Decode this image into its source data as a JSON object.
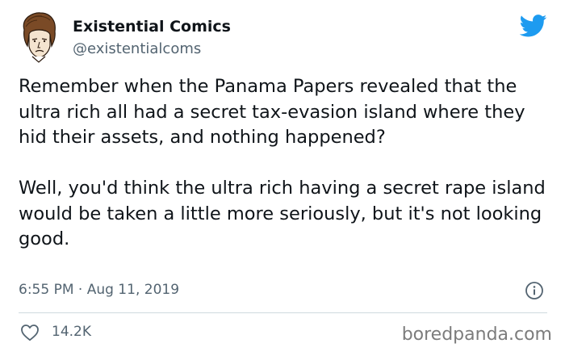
{
  "author": {
    "name": "Existential Comics",
    "handle": "@existentialcoms",
    "avatar_icon": "cartoon-face-avatar"
  },
  "platform_icon": "twitter-bird-icon",
  "brand_color": "#1d9bf0",
  "tweet": {
    "paragraphs": [
      "Remember when the Panama Papers revealed that the ultra rich all had a secret tax-evasion island where they hid their assets, and nothing happened?",
      "Well, you'd think the ultra rich having a secret rape island would be taken a little more seriously, but it's not looking good."
    ],
    "timestamp": "6:55 PM · Aug 11, 2019"
  },
  "actions": {
    "like_icon": "heart-icon",
    "like_count": "14.2K",
    "info_icon": "info-icon"
  },
  "watermark": "boredpanda.com"
}
